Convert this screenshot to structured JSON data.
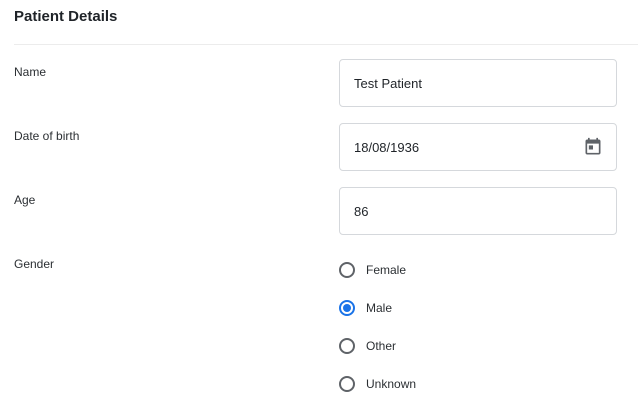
{
  "section": {
    "title": "Patient Details"
  },
  "fields": {
    "name": {
      "label": "Name",
      "value": "Test Patient"
    },
    "dob": {
      "label": "Date of birth",
      "value": "18/08/1936"
    },
    "age": {
      "label": "Age",
      "value": "86"
    }
  },
  "gender": {
    "label": "Gender",
    "selected": "Male",
    "options": [
      "Female",
      "Male",
      "Other",
      "Unknown"
    ]
  },
  "icons": {
    "calendar": "calendar-icon"
  },
  "colors": {
    "accent": "#1a73e8",
    "border": "#d5d8dc"
  }
}
